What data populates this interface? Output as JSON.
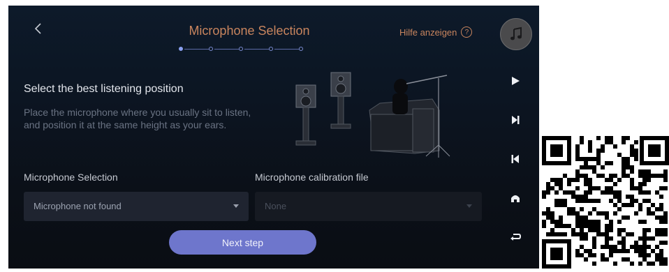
{
  "header": {
    "title": "Microphone Selection",
    "help_label": "Hilfe anzeigen",
    "help_glyph": "?",
    "step_count": 5,
    "current_step": 1
  },
  "content": {
    "heading": "Select the best listening position",
    "description": "Place the microphone where you usually sit to listen, and position it at the same height as your ears."
  },
  "form": {
    "mic_selection_label": "Microphone Selection",
    "mic_selection_value": "Microphone not found",
    "calibration_label": "Microphone calibration file",
    "calibration_value": "None"
  },
  "actions": {
    "next_label": "Next step"
  },
  "sidebar": {
    "buttons": [
      "play-icon",
      "skip-next-icon",
      "skip-previous-icon",
      "home-icon",
      "return-icon"
    ]
  },
  "colors": {
    "accent_orange": "#c9855e",
    "primary_button": "#6e76cc",
    "step_active": "#8aa0f0"
  }
}
